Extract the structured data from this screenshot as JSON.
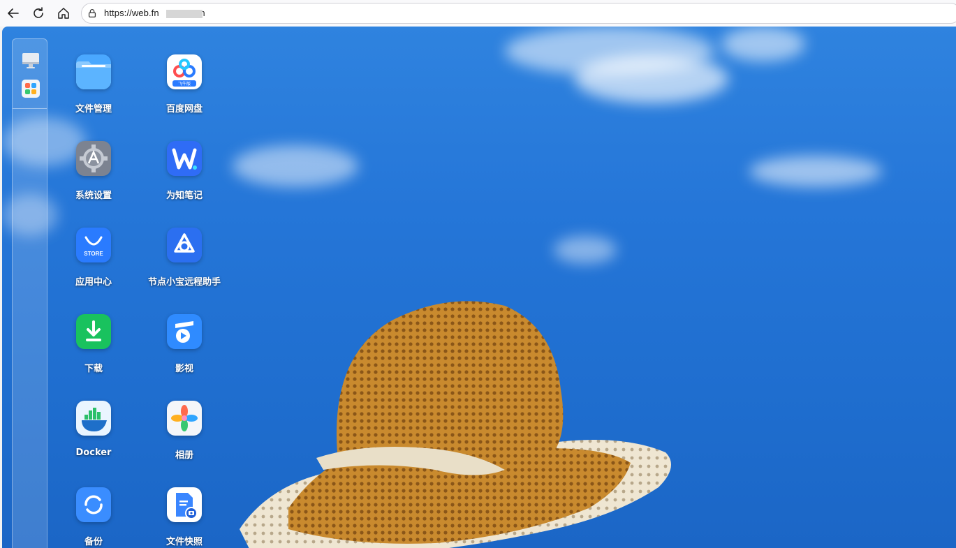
{
  "browser": {
    "url": "https://web.fn",
    "url_tail": "cn",
    "back_icon": "arrow-left-icon",
    "reload_icon": "reload-icon",
    "home_icon": "home-icon",
    "lock_icon": "lock-icon"
  },
  "dock": {
    "items": [
      {
        "icon": "desktop-icon"
      },
      {
        "icon": "app-launcher-icon"
      }
    ]
  },
  "apps": [
    {
      "label": "文件管理",
      "icon": "folder-icon"
    },
    {
      "label": "百度网盘",
      "icon": "baidu-netdisk-icon",
      "badge": "飞牛版"
    },
    {
      "label": "系统设置",
      "icon": "gear-icon"
    },
    {
      "label": "为知笔记",
      "icon": "wiz-note-icon"
    },
    {
      "label": "应用中心",
      "icon": "store-icon",
      "badge": "STORE"
    },
    {
      "label": "节点小宝远程助手",
      "icon": "node-remote-icon"
    },
    {
      "label": "下载",
      "icon": "download-icon"
    },
    {
      "label": "影视",
      "icon": "video-icon"
    },
    {
      "label": "Docker",
      "icon": "docker-icon"
    },
    {
      "label": "相册",
      "icon": "photos-icon"
    },
    {
      "label": "备份",
      "icon": "backup-icon"
    },
    {
      "label": "文件快照",
      "icon": "file-snapshot-icon"
    }
  ],
  "colors": {
    "sky": "#2576d8",
    "hat": "#c98a2e",
    "lace": "#efe6d2"
  }
}
